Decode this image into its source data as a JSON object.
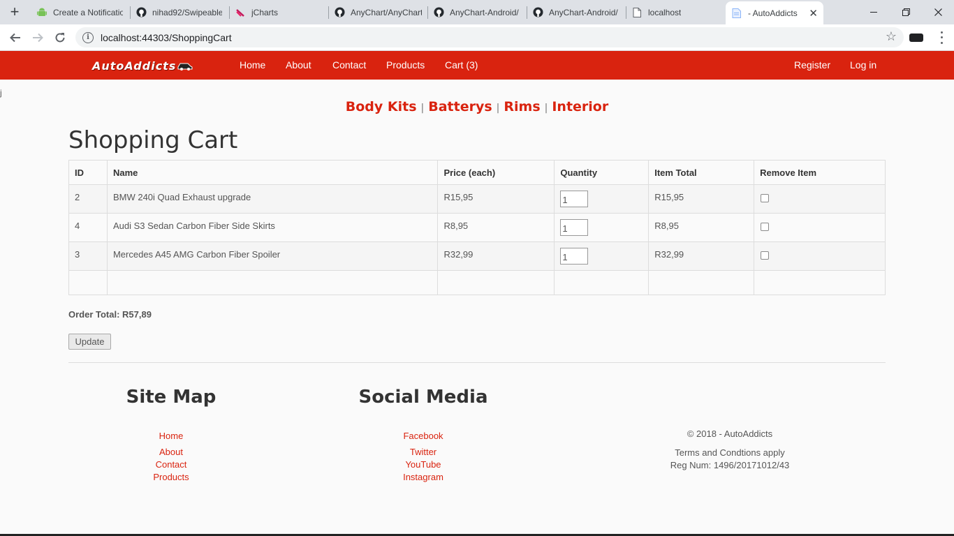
{
  "browser": {
    "tabs": [
      {
        "title": "Create a Notificatio",
        "icon": "android-icon",
        "active": false
      },
      {
        "title": "nihad92/Swipeable",
        "icon": "github-icon",
        "active": false
      },
      {
        "title": "jCharts",
        "icon": "jcharts-icon",
        "active": false
      },
      {
        "title": "AnyChart/AnyChart",
        "icon": "github-icon",
        "active": false
      },
      {
        "title": "AnyChart-Android/",
        "icon": "github-icon",
        "active": false
      },
      {
        "title": "AnyChart-Android/",
        "icon": "github-icon",
        "active": false
      },
      {
        "title": "localhost",
        "icon": "page-icon",
        "active": false
      },
      {
        "title": "- AutoAddicts",
        "icon": "page-icon",
        "active": true
      }
    ],
    "url": "localhost:44303/ShoppingCart"
  },
  "site": {
    "brand": "AutoAddicts",
    "nav": {
      "home": "Home",
      "about": "About",
      "contact": "Contact",
      "products": "Products",
      "cart": "Cart (3)",
      "register": "Register",
      "login": "Log in"
    },
    "accent_color": "#d9230f",
    "stray_text": "j"
  },
  "categories": {
    "body_kits": "Body Kits",
    "batterys": "Batterys",
    "rims": "Rims",
    "interior": "Interior",
    "separator": "|"
  },
  "cart": {
    "title": "Shopping Cart",
    "headers": {
      "id": "ID",
      "name": "Name",
      "price": "Price (each)",
      "quantity": "Quantity",
      "item_total": "Item Total",
      "remove": "Remove Item"
    },
    "rows": [
      {
        "id": "2",
        "name": "BMW 240i Quad Exhaust upgrade",
        "price": "R15,95",
        "quantity": "1",
        "total": "R15,95"
      },
      {
        "id": "4",
        "name": "Audi S3 Sedan Carbon Fiber Side Skirts",
        "price": "R8,95",
        "quantity": "1",
        "total": "R8,95"
      },
      {
        "id": "3",
        "name": "Mercedes A45 AMG Carbon Fiber Spoiler",
        "price": "R32,99",
        "quantity": "1",
        "total": "R32,99"
      }
    ],
    "order_total": "Order Total: R57,89",
    "update_label": "Update"
  },
  "footer": {
    "site_map": {
      "title": "Site Map",
      "links": {
        "home": "Home",
        "about": "About",
        "contact": "Contact",
        "products": "Products"
      }
    },
    "social": {
      "title": "Social Media",
      "links": {
        "facebook": "Facebook",
        "twitter": "Twitter",
        "youtube": "YouTube",
        "instagram": "Instagram"
      }
    },
    "copyright": "© 2018 - AutoAddicts",
    "terms": "Terms and Condtions apply",
    "reg_num": "Reg Num: 1496/20171012/43"
  }
}
